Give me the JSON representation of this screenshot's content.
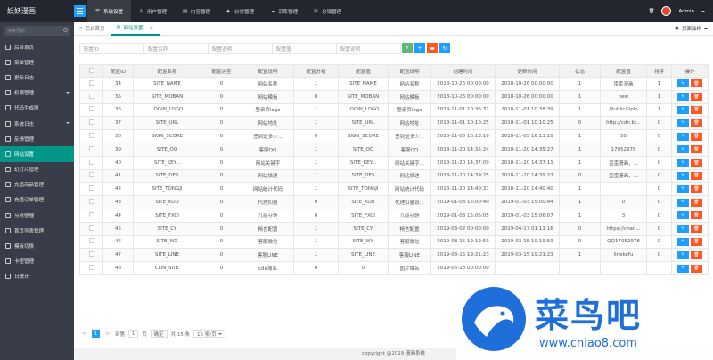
{
  "app": {
    "title": "妖妖漫画",
    "admin": "Admin"
  },
  "topnav": [
    {
      "label": "系统设置",
      "active": true
    },
    {
      "label": "用户管理"
    },
    {
      "label": "内容管理"
    },
    {
      "label": "分类管理"
    },
    {
      "label": "采集管理"
    },
    {
      "label": "分销管理"
    }
  ],
  "sidebar": {
    "search_placeholder": "搜索导航",
    "items": [
      {
        "label": "后台首页"
      },
      {
        "label": "菜单管理"
      },
      {
        "label": "更新日志"
      },
      {
        "label": "权限管理",
        "arrow": true
      },
      {
        "label": "代码生成器"
      },
      {
        "label": "系统日志",
        "arrow": true
      },
      {
        "label": "反馈管理"
      },
      {
        "label": "网站设置",
        "active": true
      },
      {
        "label": "幻灯片管理"
      },
      {
        "label": "充值商品管理"
      },
      {
        "label": "充值订单管理"
      },
      {
        "label": "分成管理"
      },
      {
        "label": "首页列表管理"
      },
      {
        "label": "模板切换"
      },
      {
        "label": "卡密管理"
      },
      {
        "label": "日统计"
      }
    ]
  },
  "tabs": [
    {
      "label": "后台首页"
    },
    {
      "label": "网站设置",
      "active": true
    }
  ],
  "page_ops": "页面操作",
  "filters": {
    "placeholders": [
      "配置ID",
      "配置名称",
      "配置说明",
      "配置值",
      "配置说明"
    ]
  },
  "table": {
    "headers": [
      "",
      "配置ID",
      "配置名称",
      "配置类型",
      "配置说明",
      "配置分组",
      "配置值",
      "配置说明",
      "创建时间",
      "更新时间",
      "状态",
      "配置值",
      "排序",
      "操作"
    ],
    "rows": [
      [
        "34",
        "SITE_NAME",
        "0",
        "网站名称",
        "1",
        "SITE_NAME",
        "网站名称",
        "2018-10-26 00:00:00",
        "2018-10-26 00:00:00",
        "1",
        "歪歪漫画",
        "1"
      ],
      [
        "35",
        "SITE_MOBAN",
        "0",
        "网站模板",
        "0",
        "SITE_MOBAN",
        "网站模板",
        "2018-10-26 00:00:00",
        "2018-10-26 00:00:00",
        "1",
        "new",
        "1"
      ],
      [
        "36",
        "LOGIN_LOGO",
        "0",
        "登录页logo",
        "1",
        "LOGIN_LOGO",
        "登录页logo",
        "2018-11-01 10:36:37",
        "2018-11-01 10:38:39",
        "1",
        "/Public/Uplo",
        "1"
      ],
      [
        "37",
        "SITE_URL",
        "0",
        "网站地址",
        "1",
        "SITE_URL",
        "网站地址",
        "2018-11-01 10:10:25",
        "2018-11-01 10:10:25",
        "0",
        "http://cdn.bl...",
        "0"
      ],
      [
        "38",
        "SIGN_SCORE",
        "0",
        "签到送多少...",
        "0",
        "SIGN_SCORE",
        "签到送多少...",
        "2018-11-05 16:13:16",
        "2018-11-05 16:13:18",
        "1",
        "50",
        "0"
      ],
      [
        "39",
        "SITE_QQ",
        "0",
        "客服QQ",
        "1",
        "SITE_QQ",
        "客服QQ",
        "2018-11-20 14:35:24",
        "2018-11-20 14:35:27",
        "1",
        "17052978",
        "0"
      ],
      [
        "40",
        "SITE_KEY...",
        "0",
        "网站关键字",
        "1",
        "SITE_KEY...",
        "网站关键字...",
        "2018-11-20 14:37:09",
        "2018-11-20 14:37:11",
        "1",
        "歪歪漫画，...",
        "0"
      ],
      [
        "41",
        "SITE_DES",
        "0",
        "网站描述",
        "1",
        "SITE_DES",
        "网站描述",
        "2018-11-20 14:39:25",
        "2018-11-20 14:39:27",
        "0",
        "歪歪漫画，...",
        "0"
      ],
      [
        "42",
        "SITE_TONGJI",
        "0",
        "网站统计代码",
        "1",
        "SITE_TONGJI",
        "网站统计代码",
        "2018-11-20 14:40:37",
        "2018-11-20 14:40:40",
        "1",
        "",
        "0"
      ],
      [
        "43",
        "SITE_KOU",
        "0",
        "代理扣量",
        "0",
        "SITE_KOU",
        "代理扣量设...",
        "2019-01-03 15:00:40",
        "2019-01-03 15:00:44",
        "1",
        "0",
        "0"
      ],
      [
        "44",
        "SITE_FXCJ",
        "0",
        "几级分销",
        "0",
        "SITE_FXCJ",
        "几级分销",
        "2019-01-03 15:06:05",
        "2019-01-03 15:06:07",
        "1",
        "3",
        "0"
      ],
      [
        "45",
        "SITE_CY",
        "0",
        "畅言配置",
        "1",
        "SITE_CY",
        "畅言配置",
        "2019-03-02 00:00:00",
        "2019-04-17 01:13:16",
        "0",
        "https://chan...",
        "0"
      ],
      [
        "46",
        "SITE_WX",
        "0",
        "客服微信",
        "1",
        "SITE_WX",
        "客服微信",
        "2019-03-15 19:19:59",
        "2019-03-15 19:19:59",
        "0",
        "QQ17052978",
        "0"
      ],
      [
        "47",
        "SITE_LINE",
        "0",
        "客服LINE",
        "1",
        "SITE_LINE",
        "客服LINE",
        "2019-03-15 19:21:23",
        "2019-03-15 19:21:23",
        "1",
        "linekefu",
        "0"
      ],
      [
        "48",
        "CDN_SITE",
        "0",
        "cdn域名",
        "0",
        "0",
        "图片域名",
        "2019-06-23 00:00:00",
        "",
        "",
        "",
        ""
      ]
    ],
    "edit_label": "✎",
    "del_label": "🗑"
  },
  "pager": {
    "prev": "<",
    "page": "1",
    "next": ">",
    "goto_label": "到第",
    "goto_value": "1",
    "page_unit": "页",
    "confirm": "确定",
    "total": "共 15 条",
    "per_page": "15 条/页"
  },
  "footer": "copyright @2019 漫画系统",
  "watermark": {
    "brand": "菜鸟吧",
    "url": "www.cniao8.com"
  },
  "colors": {
    "accent": "#009688",
    "blue": "#1e9fff",
    "red": "#ff5722",
    "topbar": "#23262e",
    "sidebar": "#393d49"
  }
}
